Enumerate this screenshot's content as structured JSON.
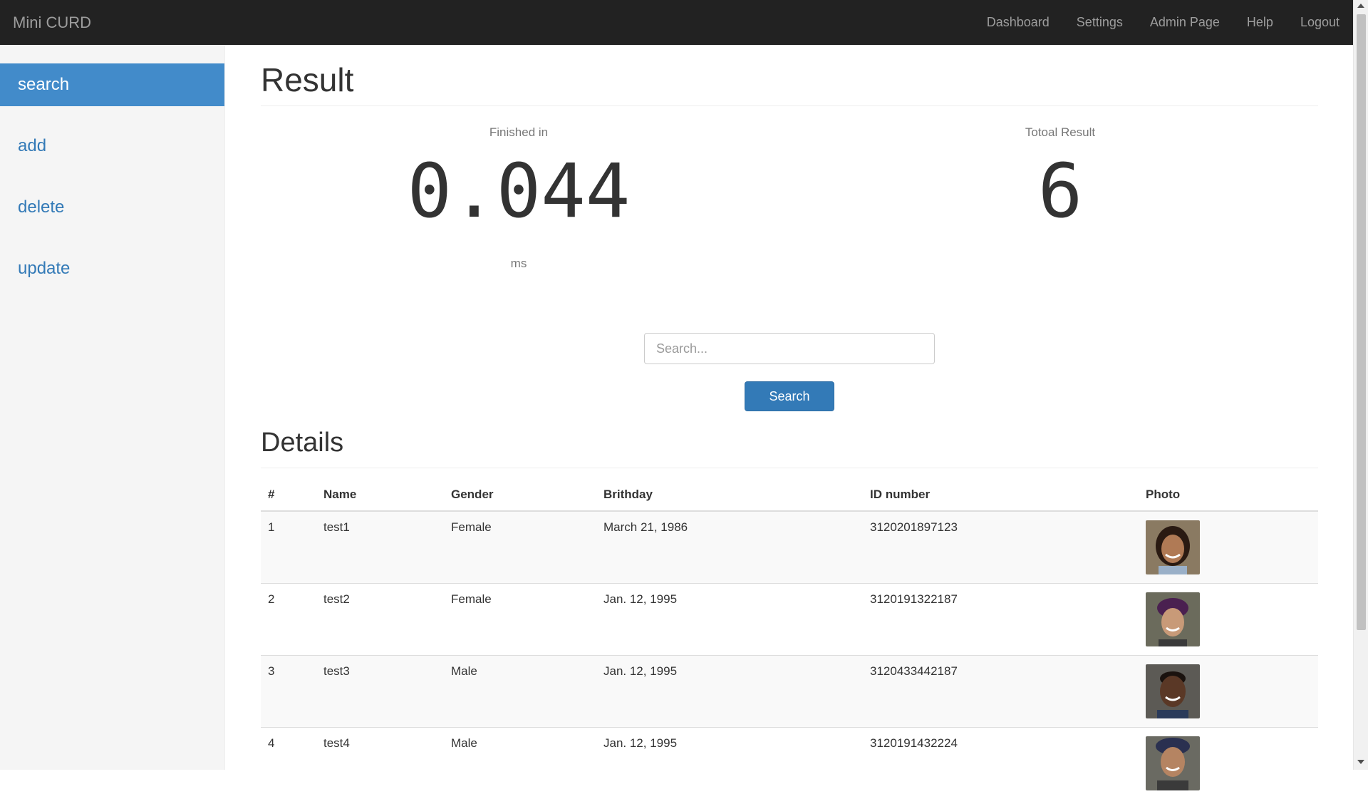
{
  "navbar": {
    "brand": "Mini CURD",
    "links": [
      "Dashboard",
      "Settings",
      "Admin Page",
      "Help",
      "Logout"
    ]
  },
  "sidebar": {
    "items": [
      {
        "label": "search",
        "active": true
      },
      {
        "label": "add",
        "active": false
      },
      {
        "label": "delete",
        "active": false
      },
      {
        "label": "update",
        "active": false
      }
    ]
  },
  "result": {
    "title": "Result",
    "finished_label": "Finished in",
    "finished_value": "0.044",
    "finished_unit": "ms",
    "total_label": "Totoal Result",
    "total_value": "6"
  },
  "search": {
    "placeholder": "Search...",
    "button_label": "Search"
  },
  "details": {
    "title": "Details",
    "columns": [
      "#",
      "Name",
      "Gender",
      "Brithday",
      "ID number",
      "Photo"
    ],
    "rows": [
      {
        "num": "1",
        "name": "test1",
        "gender": "Female",
        "birthday": "March 21, 1986",
        "id": "3120201897123",
        "photo": "photo-woman-smiling"
      },
      {
        "num": "2",
        "name": "test2",
        "gender": "Female",
        "birthday": "Jan. 12, 1995",
        "id": "3120191322187",
        "photo": "photo-woman-headscarf"
      },
      {
        "num": "3",
        "name": "test3",
        "gender": "Male",
        "birthday": "Jan. 12, 1995",
        "id": "3120433442187",
        "photo": "photo-man-smiling"
      },
      {
        "num": "4",
        "name": "test4",
        "gender": "Male",
        "birthday": "Jan. 12, 1995",
        "id": "3120191432224",
        "photo": "photo-man-cap"
      }
    ]
  },
  "colors": {
    "navbar_bg": "#222222",
    "sidebar_active": "#428bca",
    "link": "#337ab7",
    "button": "#337ab7"
  }
}
